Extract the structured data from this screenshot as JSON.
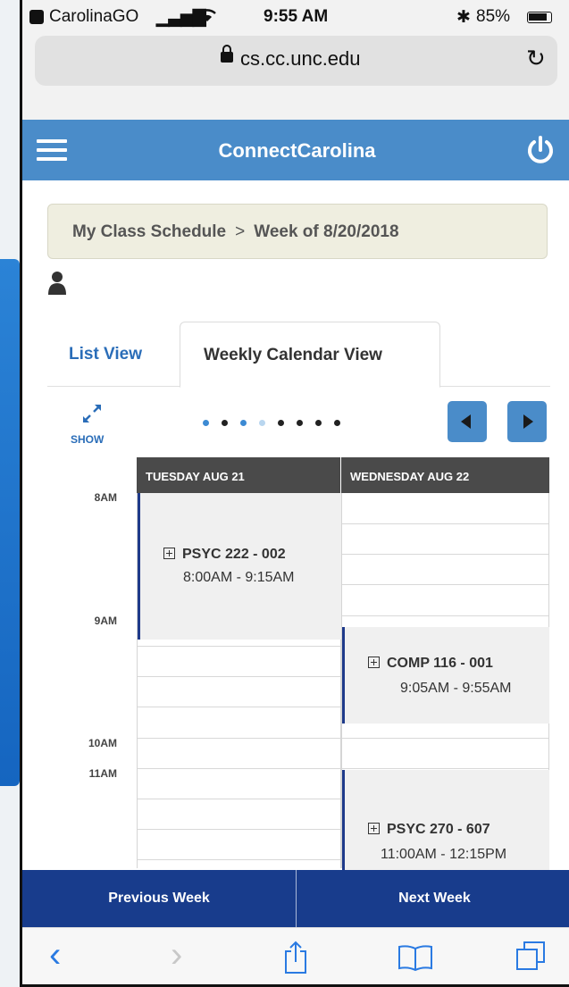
{
  "status_bar": {
    "carrier": "CarolinaGO",
    "signal_glyph": "▁▃▅▇",
    "wifi_glyph": "◠",
    "time": "9:55 AM",
    "bluetooth_glyph": "✱",
    "battery_percent": "85%",
    "battery_level": 0.85
  },
  "url_bar": {
    "url": "cs.cc.unc.edu",
    "reload_glyph": "↻"
  },
  "app_header": {
    "title": "ConnectCarolina",
    "menu_icon": "hamburger-icon",
    "power_icon": "power-icon"
  },
  "breadcrumb": {
    "items": [
      "My Class Schedule",
      "Week of 8/20/2018"
    ],
    "separator": ">"
  },
  "tabs": [
    {
      "label": "List View",
      "active": false
    },
    {
      "label": "Weekly Calendar View",
      "active": true
    }
  ],
  "show_label": "SHOW",
  "pager": {
    "count": 8,
    "active_indices": [
      0,
      2
    ],
    "light_indices": [
      3
    ]
  },
  "calendar": {
    "days": [
      "TUESDAY AUG 21",
      "WEDNESDAY AUG 22"
    ],
    "time_labels": [
      "8AM",
      "9AM",
      "10AM",
      "11AM"
    ],
    "events": [
      {
        "course": "PSYC 222 - 002",
        "time": "8:00AM - 9:15AM",
        "day": 0
      },
      {
        "course": "COMP 116 - 001",
        "time": "9:05AM - 9:55AM",
        "day": 1
      },
      {
        "course": "PSYC 270 - 607",
        "time": "11:00AM - 12:15PM",
        "day": 1
      }
    ]
  },
  "week_nav": {
    "previous": "Previous Week",
    "next": "Next Week"
  },
  "colors": {
    "header_blue": "#4a8cc9",
    "nav_navy": "#183c8c",
    "event_bar": "#1f3a8a",
    "link_blue": "#2a6db8"
  },
  "safari_toolbar": {
    "back_glyph": "‹",
    "forward_glyph": "›"
  }
}
